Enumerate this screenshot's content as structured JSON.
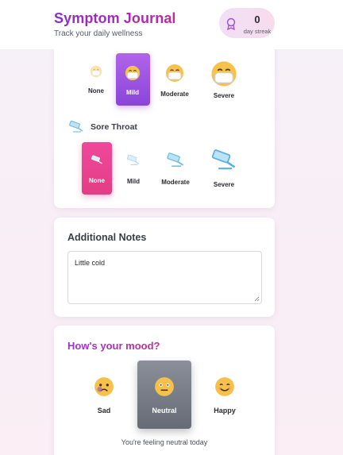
{
  "header": {
    "title": "Symptom Journal",
    "subtitle": "Track your daily wellness",
    "streak_count": "0",
    "streak_label": "day streak",
    "streak_icon": "medal-icon"
  },
  "symptoms": {
    "first": {
      "icon": "face-with-medical-mask-icon",
      "options": [
        {
          "label": "None"
        },
        {
          "label": "Mild"
        },
        {
          "label": "Moderate"
        },
        {
          "label": "Severe"
        }
      ],
      "selected": "Mild"
    },
    "sore_throat": {
      "title": "Sore Throat",
      "icon": "syringe-icon",
      "options": [
        {
          "label": "None"
        },
        {
          "label": "Mild"
        },
        {
          "label": "Moderate"
        },
        {
          "label": "Severe"
        }
      ],
      "selected": "None"
    }
  },
  "notes": {
    "title": "Additional Notes",
    "value": "Little cold"
  },
  "mood": {
    "title": "How's your mood?",
    "options": [
      {
        "label": "Sad",
        "icon": "sad-face-icon"
      },
      {
        "label": "Neutral",
        "icon": "neutral-face-icon"
      },
      {
        "label": "Happy",
        "icon": "happy-face-icon"
      }
    ],
    "selected": "Neutral",
    "status": "You're feeling neutral today"
  },
  "colors": {
    "accent_purple": "#8a45d8",
    "accent_pink": "#e33d86",
    "neutral_gray": "#6e737e"
  }
}
